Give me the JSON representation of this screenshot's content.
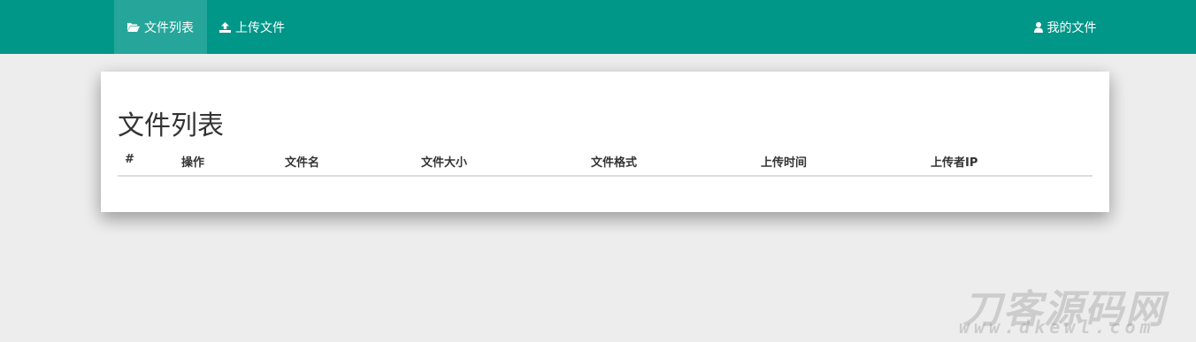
{
  "nav": {
    "files_label": "文件列表",
    "upload_label": "上传文件",
    "mine_label": "我的文件"
  },
  "main": {
    "title": "文件列表",
    "table": {
      "columns": [
        "#",
        "操作",
        "文件名",
        "文件大小",
        "文件格式",
        "上传时间",
        "上传者IP"
      ],
      "rows": []
    }
  },
  "watermark": {
    "text": "刀客源码网",
    "url": "www.dkewl.com"
  },
  "colors": {
    "primary": "#009688",
    "active_tab": "#26a69a",
    "page_background": "#ededed"
  }
}
